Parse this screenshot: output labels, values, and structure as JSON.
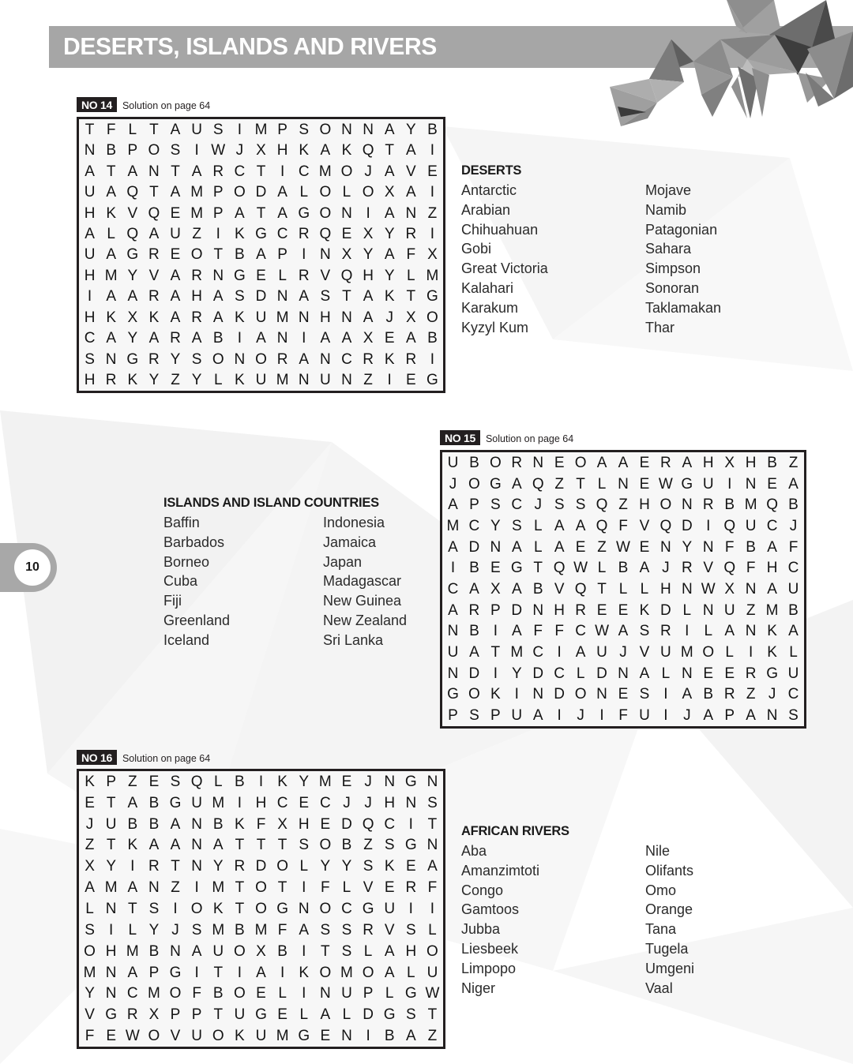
{
  "page": {
    "number": "10",
    "title": "DESERTS, ISLANDS AND RIVERS",
    "colors": {
      "title_bar": "#a6a6a6",
      "title_text": "#ffffff",
      "badge_bg": "#231f20",
      "badge_text": "#ffffff",
      "grid_border": "#231f20",
      "grid_bg": "#f7f7f7",
      "letter": "#141414",
      "page_tab": "#a8a8a8"
    }
  },
  "puzzles": [
    {
      "id": "puzzle-14",
      "badge": "NO 14",
      "solution_note": "Solution on page 64",
      "cols": 17,
      "rows": 13,
      "grid": [
        [
          "T",
          "F",
          "L",
          "T",
          "A",
          "U",
          "S",
          "I",
          "M",
          "P",
          "S",
          "O",
          "N",
          "N",
          "A",
          "Y",
          "B"
        ],
        [
          "N",
          "B",
          "P",
          "O",
          "S",
          "I",
          "W",
          "J",
          "X",
          "H",
          "K",
          "A",
          "K",
          "Q",
          "T",
          "A",
          "I"
        ],
        [
          "A",
          "T",
          "A",
          "N",
          "T",
          "A",
          "R",
          "C",
          "T",
          "I",
          "C",
          "M",
          "O",
          "J",
          "A",
          "V",
          "E"
        ],
        [
          "U",
          "A",
          "Q",
          "T",
          "A",
          "M",
          "P",
          "O",
          "D",
          "A",
          "L",
          "O",
          "L",
          "O",
          "X",
          "A",
          "I"
        ],
        [
          "H",
          "K",
          "V",
          "Q",
          "E",
          "M",
          "P",
          "A",
          "T",
          "A",
          "G",
          "O",
          "N",
          "I",
          "A",
          "N",
          "Z"
        ],
        [
          "A",
          "L",
          "Q",
          "A",
          "U",
          "Z",
          "I",
          "K",
          "G",
          "C",
          "R",
          "Q",
          "E",
          "X",
          "Y",
          "R",
          "I"
        ],
        [
          "U",
          "A",
          "G",
          "R",
          "E",
          "O",
          "T",
          "B",
          "A",
          "P",
          "I",
          "N",
          "X",
          "Y",
          "A",
          "F",
          "X"
        ],
        [
          "H",
          "M",
          "Y",
          "V",
          "A",
          "R",
          "N",
          "G",
          "E",
          "L",
          "R",
          "V",
          "Q",
          "H",
          "Y",
          "L",
          "M"
        ],
        [
          "I",
          "A",
          "A",
          "R",
          "A",
          "H",
          "A",
          "S",
          "D",
          "N",
          "A",
          "S",
          "T",
          "A",
          "K",
          "T",
          "G"
        ],
        [
          "H",
          "K",
          "X",
          "K",
          "A",
          "R",
          "A",
          "K",
          "U",
          "M",
          "N",
          "H",
          "N",
          "A",
          "J",
          "X",
          "O"
        ],
        [
          "C",
          "A",
          "Y",
          "A",
          "R",
          "A",
          "B",
          "I",
          "A",
          "N",
          "I",
          "A",
          "A",
          "X",
          "E",
          "A",
          "B"
        ],
        [
          "S",
          "N",
          "G",
          "R",
          "Y",
          "S",
          "O",
          "N",
          "O",
          "R",
          "A",
          "N",
          "C",
          "R",
          "K",
          "R",
          "I"
        ],
        [
          "H",
          "R",
          "K",
          "Y",
          "Z",
          "Y",
          "L",
          "K",
          "U",
          "M",
          "N",
          "U",
          "N",
          "Z",
          "I",
          "E",
          "G"
        ]
      ],
      "wordlist": {
        "title": "DESERTS",
        "col1": [
          "Antarctic",
          "Arabian",
          "Chihuahuan",
          "Gobi",
          "Great Victoria",
          "Kalahari",
          "Karakum",
          "Kyzyl Kum"
        ],
        "col2": [
          "Mojave",
          "Namib",
          "Patagonian",
          "Sahara",
          "Simpson",
          "Sonoran",
          "Taklamakan",
          "Thar"
        ]
      }
    },
    {
      "id": "puzzle-15",
      "badge": "NO 15",
      "solution_note": "Solution on page 64",
      "cols": 17,
      "rows": 13,
      "grid": [
        [
          "U",
          "B",
          "O",
          "R",
          "N",
          "E",
          "O",
          "A",
          "A",
          "E",
          "R",
          "A",
          "H",
          "X",
          "H",
          "B",
          "Z"
        ],
        [
          "J",
          "O",
          "G",
          "A",
          "Q",
          "Z",
          "T",
          "L",
          "N",
          "E",
          "W",
          "G",
          "U",
          "I",
          "N",
          "E",
          "A"
        ],
        [
          "A",
          "P",
          "S",
          "C",
          "J",
          "S",
          "S",
          "Q",
          "Z",
          "H",
          "O",
          "N",
          "R",
          "B",
          "M",
          "Q",
          "B"
        ],
        [
          "M",
          "C",
          "Y",
          "S",
          "L",
          "A",
          "A",
          "Q",
          "F",
          "V",
          "Q",
          "D",
          "I",
          "Q",
          "U",
          "C",
          "J"
        ],
        [
          "A",
          "D",
          "N",
          "A",
          "L",
          "A",
          "E",
          "Z",
          "W",
          "E",
          "N",
          "Y",
          "N",
          "F",
          "B",
          "A",
          "F"
        ],
        [
          "I",
          "B",
          "E",
          "G",
          "T",
          "Q",
          "W",
          "L",
          "B",
          "A",
          "J",
          "R",
          "V",
          "Q",
          "F",
          "H",
          "C"
        ],
        [
          "C",
          "A",
          "X",
          "A",
          "B",
          "V",
          "Q",
          "T",
          "L",
          "L",
          "H",
          "N",
          "W",
          "X",
          "N",
          "A",
          "U"
        ],
        [
          "A",
          "R",
          "P",
          "D",
          "N",
          "H",
          "R",
          "E",
          "E",
          "K",
          "D",
          "L",
          "N",
          "U",
          "Z",
          "M",
          "B"
        ],
        [
          "N",
          "B",
          "I",
          "A",
          "F",
          "F",
          "C",
          "W",
          "A",
          "S",
          "R",
          "I",
          "L",
          "A",
          "N",
          "K",
          "A"
        ],
        [
          "U",
          "A",
          "T",
          "M",
          "C",
          "I",
          "A",
          "U",
          "J",
          "V",
          "U",
          "M",
          "O",
          "L",
          "I",
          "K",
          "L"
        ],
        [
          "N",
          "D",
          "I",
          "Y",
          "D",
          "C",
          "L",
          "D",
          "N",
          "A",
          "L",
          "N",
          "E",
          "E",
          "R",
          "G",
          "U"
        ],
        [
          "G",
          "O",
          "K",
          "I",
          "N",
          "D",
          "O",
          "N",
          "E",
          "S",
          "I",
          "A",
          "B",
          "R",
          "Z",
          "J",
          "C"
        ],
        [
          "P",
          "S",
          "P",
          "U",
          "A",
          "I",
          "J",
          "I",
          "F",
          "U",
          "I",
          "J",
          "A",
          "P",
          "A",
          "N",
          "S"
        ]
      ],
      "wordlist": {
        "title": "ISLANDS AND ISLAND COUNTRIES",
        "col1": [
          "Baffin",
          "Barbados",
          "Borneo",
          "Cuba",
          "Fiji",
          "Greenland",
          "Iceland"
        ],
        "col2": [
          "Indonesia",
          "Jamaica",
          "Japan",
          "Madagascar",
          "New Guinea",
          "New Zealand",
          "Sri Lanka"
        ]
      }
    },
    {
      "id": "puzzle-16",
      "badge": "NO 16",
      "solution_note": "Solution on page 64",
      "cols": 17,
      "rows": 14,
      "grid": [
        [
          "K",
          "P",
          "Z",
          "E",
          "S",
          "Q",
          "L",
          "B",
          "I",
          "K",
          "Y",
          "M",
          "E",
          "J",
          "N",
          "G",
          "N"
        ],
        [
          "E",
          "T",
          "A",
          "B",
          "G",
          "U",
          "M",
          "I",
          "H",
          "C",
          "E",
          "C",
          "J",
          "J",
          "H",
          "N",
          "S"
        ],
        [
          "J",
          "U",
          "B",
          "B",
          "A",
          "N",
          "B",
          "K",
          "F",
          "X",
          "H",
          "E",
          "D",
          "Q",
          "C",
          "I",
          "T"
        ],
        [
          "Z",
          "T",
          "K",
          "A",
          "A",
          "N",
          "A",
          "T",
          "T",
          "T",
          "S",
          "O",
          "B",
          "Z",
          "S",
          "G",
          "N"
        ],
        [
          "X",
          "Y",
          "I",
          "R",
          "T",
          "N",
          "Y",
          "R",
          "D",
          "O",
          "L",
          "Y",
          "Y",
          "S",
          "K",
          "E",
          "A"
        ],
        [
          "A",
          "M",
          "A",
          "N",
          "Z",
          "I",
          "M",
          "T",
          "O",
          "T",
          "I",
          "F",
          "L",
          "V",
          "E",
          "R",
          "F"
        ],
        [
          "L",
          "N",
          "T",
          "S",
          "I",
          "O",
          "K",
          "T",
          "O",
          "G",
          "N",
          "O",
          "C",
          "G",
          "U",
          "I",
          "I"
        ],
        [
          "S",
          "I",
          "L",
          "Y",
          "J",
          "S",
          "M",
          "B",
          "M",
          "F",
          "A",
          "S",
          "S",
          "R",
          "V",
          "S",
          "L"
        ],
        [
          "O",
          "H",
          "M",
          "B",
          "N",
          "A",
          "U",
          "O",
          "X",
          "B",
          "I",
          "T",
          "S",
          "L",
          "A",
          "H",
          "O"
        ],
        [
          "M",
          "N",
          "A",
          "P",
          "G",
          "I",
          "T",
          "I",
          "A",
          "I",
          "K",
          "O",
          "M",
          "O",
          "A",
          "L",
          "U"
        ],
        [
          "Y",
          "N",
          "C",
          "M",
          "O",
          "F",
          "B",
          "O",
          "E",
          "L",
          "I",
          "N",
          "U",
          "P",
          "L",
          "G",
          "W"
        ],
        [
          "V",
          "G",
          "R",
          "X",
          "P",
          "P",
          "T",
          "U",
          "G",
          "E",
          "L",
          "A",
          "L",
          "D",
          "G",
          "S",
          "T"
        ],
        [
          "F",
          "E",
          "W",
          "O",
          "V",
          "U",
          "O",
          "K",
          "U",
          "M",
          "G",
          "E",
          "N",
          "I",
          "B",
          "A",
          "Z"
        ]
      ],
      "wordlist": {
        "title": "AFRICAN RIVERS",
        "col1": [
          "Aba",
          "Amanzimtoti",
          "Congo",
          "Gamtoos",
          "Jubba",
          "Liesbeek",
          "Limpopo",
          "Niger"
        ],
        "col2": [
          "Nile",
          "Olifants",
          "Omo",
          "Orange",
          "Tana",
          "Tugela",
          "Umgeni",
          "Vaal"
        ]
      }
    }
  ]
}
